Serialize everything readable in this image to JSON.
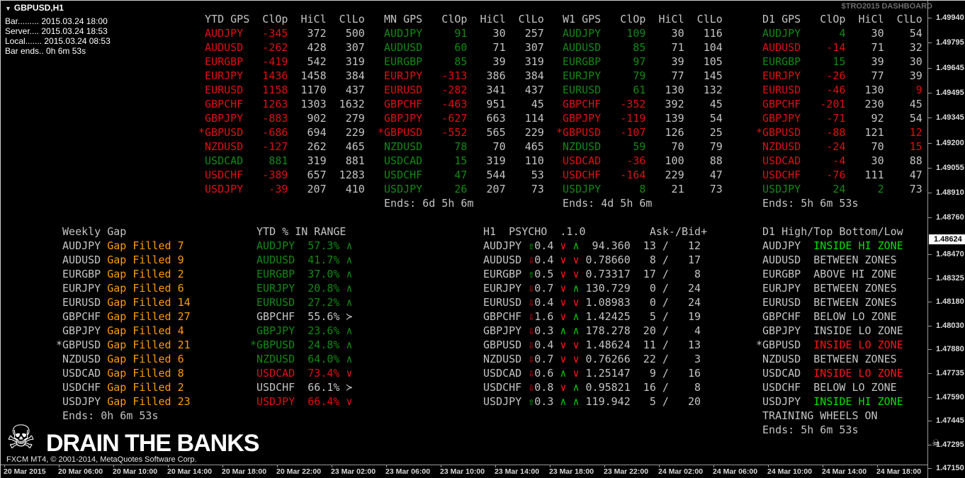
{
  "window": {
    "title": "GBPUSD,H1",
    "info_lines": [
      "Bar......... 2015.03.24 18:00",
      "Server.... 2015.03.24 18:53",
      "Local....... 2015.03.24 08:53",
      "Bar ends.. 0h 6m 53s"
    ],
    "watermark": "$TRO2015 DASHBOARD"
  },
  "colors": {
    "red": "#e01010",
    "green": "#128912",
    "bright_green": "#00e100",
    "zone_red": "#ff1414",
    "gray": "#c4c4c4",
    "orange": "#ff9c00",
    "white": "#ffffff"
  },
  "gps_tables": [
    {
      "title": "YTD GPS",
      "cols": [
        "ClOp",
        "HiCl",
        "ClLo"
      ],
      "ends": "",
      "rows": [
        {
          "sym": "AUDJPY",
          "star": false,
          "c": "r",
          "clop": "-345",
          "hicl": "372",
          "cllo": "500"
        },
        {
          "sym": "AUDUSD",
          "star": false,
          "c": "r",
          "clop": "-262",
          "hicl": "428",
          "cllo": "307"
        },
        {
          "sym": "EURGBP",
          "star": false,
          "c": "r",
          "clop": "-419",
          "hicl": "542",
          "cllo": "319"
        },
        {
          "sym": "EURJPY",
          "star": false,
          "c": "r",
          "clop": "1436",
          "hicl": "1458",
          "cllo": "384"
        },
        {
          "sym": "EURUSD",
          "star": false,
          "c": "r",
          "clop": "1158",
          "hicl": "1170",
          "cllo": "437"
        },
        {
          "sym": "GBPCHF",
          "star": false,
          "c": "r",
          "clop": "1263",
          "hicl": "1303",
          "cllo": "1632"
        },
        {
          "sym": "GBPJPY",
          "star": false,
          "c": "r",
          "clop": "-883",
          "hicl": "902",
          "cllo": "279"
        },
        {
          "sym": "GBPUSD",
          "star": true,
          "c": "r",
          "clop": "-686",
          "hicl": "694",
          "cllo": "229"
        },
        {
          "sym": "NZDUSD",
          "star": false,
          "c": "r",
          "clop": "-127",
          "hicl": "262",
          "cllo": "465"
        },
        {
          "sym": "USDCAD",
          "star": false,
          "c": "g",
          "clop": "881",
          "hicl": "319",
          "cllo": "881"
        },
        {
          "sym": "USDCHF",
          "star": false,
          "c": "r",
          "clop": "-389",
          "hicl": "657",
          "cllo": "1283"
        },
        {
          "sym": "USDJPY",
          "star": false,
          "c": "r",
          "clop": "-39",
          "hicl": "207",
          "cllo": "410"
        }
      ]
    },
    {
      "title": "MN GPS",
      "cols": [
        "ClOp",
        "HiCl",
        "ClLo"
      ],
      "ends": "Ends: 6d 5h 6m",
      "rows": [
        {
          "sym": "AUDJPY",
          "star": false,
          "c": "g",
          "clop": "91",
          "hicl": "30",
          "cllo": "257"
        },
        {
          "sym": "AUDUSD",
          "star": false,
          "c": "g",
          "clop": "60",
          "hicl": "71",
          "cllo": "307"
        },
        {
          "sym": "EURGBP",
          "star": false,
          "c": "g",
          "clop": "85",
          "hicl": "39",
          "cllo": "319"
        },
        {
          "sym": "EURJPY",
          "star": false,
          "c": "r",
          "clop": "-313",
          "hicl": "386",
          "cllo": "384"
        },
        {
          "sym": "EURUSD",
          "star": false,
          "c": "r",
          "clop": "-282",
          "hicl": "341",
          "cllo": "437"
        },
        {
          "sym": "GBPCHF",
          "star": false,
          "c": "r",
          "clop": "-463",
          "hicl": "951",
          "cllo": "45"
        },
        {
          "sym": "GBPJPY",
          "star": false,
          "c": "r",
          "clop": "-627",
          "hicl": "663",
          "cllo": "114"
        },
        {
          "sym": "GBPUSD",
          "star": true,
          "c": "r",
          "clop": "-552",
          "hicl": "565",
          "cllo": "229"
        },
        {
          "sym": "NZDUSD",
          "star": false,
          "c": "g",
          "clop": "78",
          "hicl": "70",
          "cllo": "465"
        },
        {
          "sym": "USDCAD",
          "star": false,
          "c": "g",
          "clop": "15",
          "hicl": "319",
          "cllo": "110"
        },
        {
          "sym": "USDCHF",
          "star": false,
          "c": "g",
          "clop": "47",
          "hicl": "544",
          "cllo": "53"
        },
        {
          "sym": "USDJPY",
          "star": false,
          "c": "g",
          "clop": "26",
          "hicl": "207",
          "cllo": "73"
        }
      ]
    },
    {
      "title": "W1 GPS",
      "cols": [
        "ClOp",
        "HiCl",
        "ClLo"
      ],
      "ends": "Ends: 4d 5h 6m",
      "rows": [
        {
          "sym": "AUDJPY",
          "star": false,
          "c": "g",
          "clop": "109",
          "hicl": "30",
          "cllo": "116"
        },
        {
          "sym": "AUDUSD",
          "star": false,
          "c": "g",
          "clop": "85",
          "hicl": "71",
          "cllo": "104"
        },
        {
          "sym": "EURGBP",
          "star": false,
          "c": "g",
          "clop": "97",
          "hicl": "39",
          "cllo": "105"
        },
        {
          "sym": "EURJPY",
          "star": false,
          "c": "g",
          "clop": "79",
          "hicl": "77",
          "cllo": "145"
        },
        {
          "sym": "EURUSD",
          "star": false,
          "c": "g",
          "clop": "61",
          "hicl": "130",
          "cllo": "132"
        },
        {
          "sym": "GBPCHF",
          "star": false,
          "c": "r",
          "clop": "-352",
          "hicl": "392",
          "cllo": "45"
        },
        {
          "sym": "GBPJPY",
          "star": false,
          "c": "r",
          "clop": "-119",
          "hicl": "139",
          "cllo": "54"
        },
        {
          "sym": "GBPUSD",
          "star": true,
          "c": "r",
          "clop": "-107",
          "hicl": "126",
          "cllo": "25"
        },
        {
          "sym": "NZDUSD",
          "star": false,
          "c": "g",
          "clop": "59",
          "hicl": "70",
          "cllo": "79"
        },
        {
          "sym": "USDCAD",
          "star": false,
          "c": "r",
          "clop": "-36",
          "hicl": "100",
          "cllo": "88"
        },
        {
          "sym": "USDCHF",
          "star": false,
          "c": "r",
          "clop": "-164",
          "hicl": "229",
          "cllo": "47"
        },
        {
          "sym": "USDJPY",
          "star": false,
          "c": "g",
          "clop": "8",
          "hicl": "21",
          "cllo": "73"
        }
      ]
    },
    {
      "title": "D1 GPS",
      "cols": [
        "ClOp",
        "HiCl",
        "ClLo"
      ],
      "ends": "Ends: 5h 6m 53s",
      "rows": [
        {
          "sym": "AUDJPY",
          "star": false,
          "c": "g",
          "clop": "4",
          "hicl": "30",
          "cllo": "54"
        },
        {
          "sym": "AUDUSD",
          "star": false,
          "c": "r",
          "clop": "-14",
          "hicl": "71",
          "cllo": "32"
        },
        {
          "sym": "EURGBP",
          "star": false,
          "c": "g",
          "clop": "15",
          "hicl": "39",
          "cllo": "30"
        },
        {
          "sym": "EURJPY",
          "star": false,
          "c": "r",
          "clop": "-26",
          "hicl": "77",
          "cllo": "39"
        },
        {
          "sym": "EURUSD",
          "star": false,
          "c": "r",
          "clop": "-46",
          "hicl": "130",
          "cllo": "9",
          "lc": "r"
        },
        {
          "sym": "GBPCHF",
          "star": false,
          "c": "r",
          "clop": "-201",
          "hicl": "230",
          "cllo": "45"
        },
        {
          "sym": "GBPJPY",
          "star": false,
          "c": "r",
          "clop": "-71",
          "hicl": "92",
          "cllo": "54"
        },
        {
          "sym": "GBPUSD",
          "star": true,
          "c": "r",
          "clop": "-88",
          "hicl": "121",
          "cllo": "12",
          "lc": "r"
        },
        {
          "sym": "NZDUSD",
          "star": false,
          "c": "r",
          "clop": "-24",
          "hicl": "70",
          "cllo": "15",
          "lc": "r"
        },
        {
          "sym": "USDCAD",
          "star": false,
          "c": "r",
          "clop": "-4",
          "hicl": "30",
          "cllo": "88"
        },
        {
          "sym": "USDCHF",
          "star": false,
          "c": "r",
          "clop": "-76",
          "hicl": "111",
          "cllo": "47"
        },
        {
          "sym": "USDJPY",
          "star": false,
          "c": "g",
          "clop": "24",
          "hicl": "2",
          "hc": "g",
          "cllo": "73"
        }
      ]
    }
  ],
  "weekly_gap": {
    "title": "Weekly Gap",
    "ends": "Ends: 0h 6m 53s",
    "rows": [
      {
        "sym": "AUDJPY",
        "star": false,
        "text": "Gap Filled 7"
      },
      {
        "sym": "AUDUSD",
        "star": false,
        "text": "Gap Filled 9"
      },
      {
        "sym": "EURGBP",
        "star": false,
        "text": "Gap Filled 2"
      },
      {
        "sym": "EURJPY",
        "star": false,
        "text": "Gap Filled 6"
      },
      {
        "sym": "EURUSD",
        "star": false,
        "text": "Gap Filled 14"
      },
      {
        "sym": "GBPCHF",
        "star": false,
        "text": "Gap Filled 27"
      },
      {
        "sym": "GBPJPY",
        "star": false,
        "text": "Gap Filled 4"
      },
      {
        "sym": "GBPUSD",
        "star": true,
        "text": "Gap Filled 21"
      },
      {
        "sym": "NZDUSD",
        "star": false,
        "text": "Gap Filled 6"
      },
      {
        "sym": "USDCAD",
        "star": false,
        "text": "Gap Filled 8"
      },
      {
        "sym": "USDCHF",
        "star": false,
        "text": "Gap Filled 2"
      },
      {
        "sym": "USDJPY",
        "star": false,
        "text": "Gap Filled 23"
      }
    ]
  },
  "ytd_range": {
    "title": "YTD % IN RANGE",
    "rows": [
      {
        "sym": "AUDJPY",
        "star": false,
        "pct": "57.3%",
        "dir": "up",
        "c": "g"
      },
      {
        "sym": "AUDUSD",
        "star": false,
        "pct": "41.7%",
        "dir": "up",
        "c": "g"
      },
      {
        "sym": "EURGBP",
        "star": false,
        "pct": "37.0%",
        "dir": "up",
        "c": "g"
      },
      {
        "sym": "EURJPY",
        "star": false,
        "pct": "20.8%",
        "dir": "up",
        "c": "g"
      },
      {
        "sym": "EURUSD",
        "star": false,
        "pct": "27.2%",
        "dir": "up",
        "c": "g"
      },
      {
        "sym": "GBPCHF",
        "star": false,
        "pct": "55.6%",
        "dir": "right",
        "c": "y"
      },
      {
        "sym": "GBPJPY",
        "star": false,
        "pct": "23.6%",
        "dir": "up",
        "c": "g"
      },
      {
        "sym": "GBPUSD",
        "star": true,
        "pct": "24.8%",
        "dir": "up",
        "c": "g"
      },
      {
        "sym": "NZDUSD",
        "star": false,
        "pct": "64.0%",
        "dir": "up",
        "c": "g"
      },
      {
        "sym": "USDCAD",
        "star": false,
        "pct": "73.4%",
        "dir": "down",
        "c": "r"
      },
      {
        "sym": "USDCHF",
        "star": false,
        "pct": "66.1%",
        "dir": "right",
        "c": "y"
      },
      {
        "sym": "USDJPY",
        "star": false,
        "pct": "66.4%",
        "dir": "down",
        "c": "r"
      }
    ]
  },
  "psycho": {
    "title": "H1  PSYCHO  .1.0",
    "right_title": "Ask-/Bid+",
    "rows": [
      {
        "sym": "AUDJPY",
        "big": "up",
        "delta": "0.4",
        "ch1": "down",
        "ch2": "up",
        "price": "94.360",
        "ask": "13",
        "bid": "12"
      },
      {
        "sym": "AUDUSD",
        "big": "down",
        "delta": "0.4",
        "ch1": "down",
        "ch2": "down",
        "price": "0.78660",
        "ask": "8",
        "bid": "17"
      },
      {
        "sym": "EURGBP",
        "big": "up",
        "delta": "0.5",
        "ch1": "down",
        "ch2": "down",
        "price": "0.73317",
        "ask": "17",
        "bid": "8"
      },
      {
        "sym": "EURJPY",
        "big": "down",
        "delta": "0.7",
        "ch1": "down",
        "ch2": "up",
        "price": "130.729",
        "ask": "0",
        "bid": "24"
      },
      {
        "sym": "EURUSD",
        "big": "down",
        "delta": "0.4",
        "ch1": "down",
        "ch2": "down",
        "price": "1.08983",
        "ask": "0",
        "bid": "24"
      },
      {
        "sym": "GBPCHF",
        "big": "down",
        "delta": "1.6",
        "ch1": "down",
        "ch2": "up",
        "price": "1.42425",
        "ask": "5",
        "bid": "19"
      },
      {
        "sym": "GBPJPY",
        "big": "down",
        "delta": "0.3",
        "ch1": "up",
        "ch2": "up",
        "price": "178.278",
        "ask": "20",
        "bid": "4"
      },
      {
        "sym": "GBPUSD",
        "big": "down",
        "delta": "0.4",
        "ch1": "down",
        "ch2": "down",
        "price": "1.48624",
        "ask": "11",
        "bid": "13"
      },
      {
        "sym": "NZDUSD",
        "big": "down",
        "delta": "0.7",
        "ch1": "down",
        "ch2": "down",
        "price": "0.76266",
        "ask": "22",
        "bid": "3"
      },
      {
        "sym": "USDCAD",
        "big": "down",
        "delta": "0.6",
        "ch1": "up",
        "ch2": "down",
        "price": "1.25147",
        "ask": "9",
        "bid": "16"
      },
      {
        "sym": "USDCHF",
        "big": "down",
        "delta": "0.8",
        "ch1": "down",
        "ch2": "up",
        "price": "0.95821",
        "ask": "16",
        "bid": "8"
      },
      {
        "sym": "USDJPY",
        "big": "up",
        "delta": "0.3",
        "ch1": "up",
        "ch2": "up",
        "price": "119.942",
        "ask": "5",
        "bid": "20"
      }
    ]
  },
  "zones": {
    "title": "D1 High/Top Bottom/Low",
    "extra": "TRAINING WHEELS ON",
    "ends": "Ends: 5h 6m 53s",
    "rows": [
      {
        "sym": "AUDJPY",
        "star": false,
        "text": "INSIDE HI ZONE",
        "c": "G"
      },
      {
        "sym": "AUDUSD",
        "star": false,
        "text": "BETWEEN ZONES",
        "c": "y"
      },
      {
        "sym": "EURGBP",
        "star": false,
        "text": "ABOVE HI ZONE",
        "c": "y"
      },
      {
        "sym": "EURJPY",
        "star": false,
        "text": "BETWEEN ZONES",
        "c": "y"
      },
      {
        "sym": "EURUSD",
        "star": false,
        "text": "BETWEEN ZONES",
        "c": "y"
      },
      {
        "sym": "GBPCHF",
        "star": false,
        "text": "BELOW LO ZONE",
        "c": "y"
      },
      {
        "sym": "GBPJPY",
        "star": false,
        "text": "INSIDE LO ZONE",
        "c": "y"
      },
      {
        "sym": "GBPUSD",
        "star": true,
        "text": "INSIDE LO ZONE",
        "c": "R"
      },
      {
        "sym": "NZDUSD",
        "star": false,
        "text": "BETWEEN ZONES",
        "c": "y"
      },
      {
        "sym": "USDCAD",
        "star": false,
        "text": "INSIDE LO ZONE",
        "c": "R"
      },
      {
        "sym": "USDCHF",
        "star": false,
        "text": "BELOW LO ZONE",
        "c": "y"
      },
      {
        "sym": "USDJPY",
        "star": false,
        "text": "INSIDE HI ZONE",
        "c": "G"
      }
    ]
  },
  "price_scale": {
    "current": "1.48624",
    "labels_above": [
      "1.49940",
      "1.49795",
      "1.49645",
      "1.49495",
      "1.49345",
      "1.49200",
      "1.49055",
      "1.48910",
      "1.48760"
    ],
    "labels_below": [
      "1.48470",
      "1.48325",
      "1.48180",
      "1.48030",
      "1.47880",
      "1.47735",
      "1.47590",
      "1.47445",
      "1.47295",
      "1.47150"
    ]
  },
  "time_axis": [
    "20 Mar 2015",
    "20 Mar 06:00",
    "20 Mar 10:00",
    "20 Mar 14:00",
    "20 Mar 18:00",
    "20 Mar 22:00",
    "23 Mar 02:00",
    "23 Mar 06:00",
    "23 Mar 10:00",
    "23 Mar 14:00",
    "23 Mar 18:00",
    "23 Mar 22:00",
    "24 Mar 02:00",
    "24 Mar 06:00",
    "24 Mar 10:00",
    "24 Mar 14:00",
    "24 Mar 18:00"
  ],
  "branding": {
    "big_text": "DRAIN THE BANKS",
    "copyright": "FXCM MT4, © 2001-2014, MetaQuotes Software Corp."
  }
}
